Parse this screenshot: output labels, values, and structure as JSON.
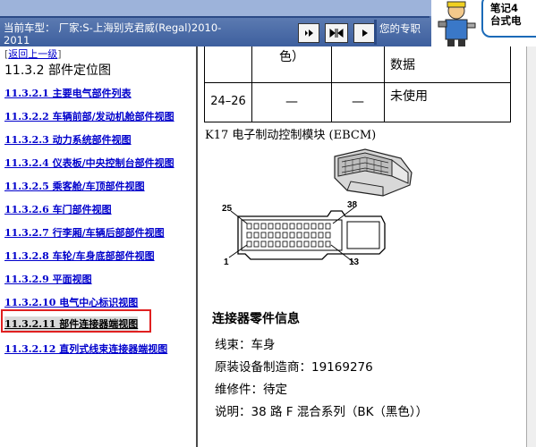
{
  "header": {
    "current_model_label": "当前车型：",
    "current_model_value": "厂家:S-上海别克君威(Regal)2010-2011",
    "favorites_label": "您的专职",
    "nav_prev_icon": "play-icon",
    "nav_sync_icon": "sync-icon",
    "nav_next_icon": "play-icon",
    "promo_line1": "笔记4",
    "promo_line2": "台式电"
  },
  "sidebar": {
    "back_open": "[",
    "back_label": "返回上一级",
    "back_close": "]",
    "section_title": "11.3.2 部件定位图",
    "items": [
      {
        "label": "11.3.2.1 主要电气部件列表"
      },
      {
        "label": "11.3.2.2 车辆前部/发动机舱部件视图"
      },
      {
        "label": "11.3.2.3 动力系统部件视图"
      },
      {
        "label": "11.3.2.4 仪表板/中央控制台部件视图"
      },
      {
        "label": "11.3.2.5 乘客舱/车顶部件视图"
      },
      {
        "label": "11.3.2.6 车门部件视图"
      },
      {
        "label": "11.3.2.7 行李厢/车辆后部部件视图"
      },
      {
        "label": "11.3.2.8 车轮/车身底部部件视图"
      },
      {
        "label": "11.3.2.9 平面视图"
      },
      {
        "label": "11.3.2.10 电气中心标识视图"
      },
      {
        "label": "11.3.2.11 部件连接器端视图"
      },
      {
        "label": "11.3.2.12 直列式线束连接器端视图"
      }
    ],
    "selected_index": 10
  },
  "pin_table": {
    "row0": {
      "col2": "色）",
      "col4": "数据"
    },
    "row1": {
      "pin": "24–26",
      "col2": "—",
      "col3": "—",
      "desc": "未使用"
    }
  },
  "module": {
    "title": "K17 电子制动控制模块 (EBCM)",
    "pin_labels": {
      "p25": "25",
      "p38": "38",
      "p1": "1",
      "p13": "13"
    }
  },
  "connector_info": {
    "title": "连接器零件信息",
    "harness": "线束：车身",
    "oem": "原装设备制造商：19169276",
    "service": "维修件：待定",
    "description": "说明：38 路 F 混合系列（BK（黑色））"
  }
}
